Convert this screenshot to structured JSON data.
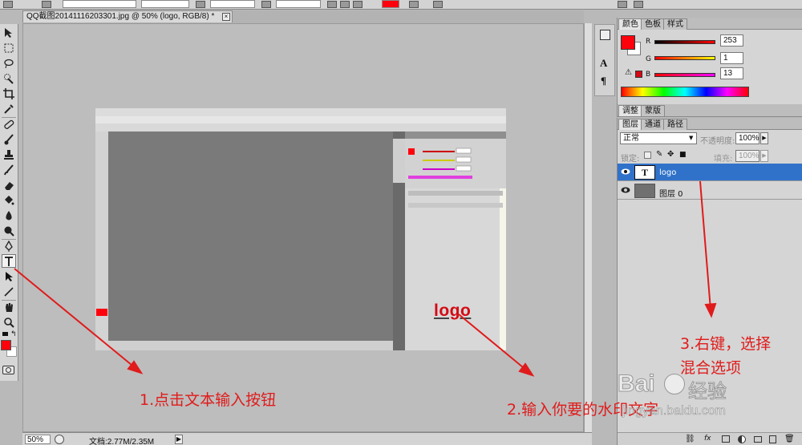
{
  "document": {
    "tab_title": "QQ截图20141116203301.jpg @ 50% (logo, RGB/8) *",
    "close_glyph": "×"
  },
  "status": {
    "zoom": "50%",
    "doc_info": "文档:2.77M/2.35M"
  },
  "color_panel": {
    "tabs": [
      "颜色",
      "色板",
      "样式"
    ],
    "channels": [
      {
        "label": "R",
        "value": "253"
      },
      {
        "label": "G",
        "value": "1"
      },
      {
        "label": "B",
        "value": "13"
      }
    ],
    "foreground_color": "#fd010d"
  },
  "adjust_panel": {
    "tabs": [
      "调整",
      "蒙版"
    ]
  },
  "layers_panel": {
    "tabs": [
      "图层",
      "通道",
      "路径"
    ],
    "blend_mode": "正常",
    "opacity_label": "不透明度:",
    "opacity_value": "100%",
    "lock_label": "锁定:",
    "fill_label": "填充:",
    "fill_value": "100%",
    "layers": [
      {
        "name": "logo",
        "thumb": "T",
        "selected": true
      },
      {
        "name": "图层 0",
        "thumb": "",
        "selected": false
      }
    ]
  },
  "canvas_logo_text": "logo",
  "annotations": {
    "step1": "1.点击文本输入按钮",
    "step2": "2.输入你要的水印文字",
    "step3_line1": "3.右键，选择",
    "step3_line2": "混合选项"
  },
  "accent_color": "#e01b1b",
  "selection_color": "#3072c9",
  "watermark": {
    "brand": "Bai",
    "brand_cn": "经验",
    "url": "jingyan.baidu.com"
  },
  "icons": [
    "move-icon",
    "marquee-icon",
    "lasso-icon",
    "quick-select-icon",
    "crop-icon",
    "eyedropper-icon",
    "healing-icon",
    "brush-icon",
    "clone-stamp-icon",
    "history-brush-icon",
    "eraser-icon",
    "paint-bucket-icon",
    "blur-icon",
    "dodge-icon",
    "pen-icon",
    "type-icon",
    "path-select-icon",
    "line-icon",
    "hand-icon",
    "zoom-icon",
    "eye-icon",
    "link-icon",
    "fx-icon",
    "mask-icon",
    "trash-icon"
  ]
}
